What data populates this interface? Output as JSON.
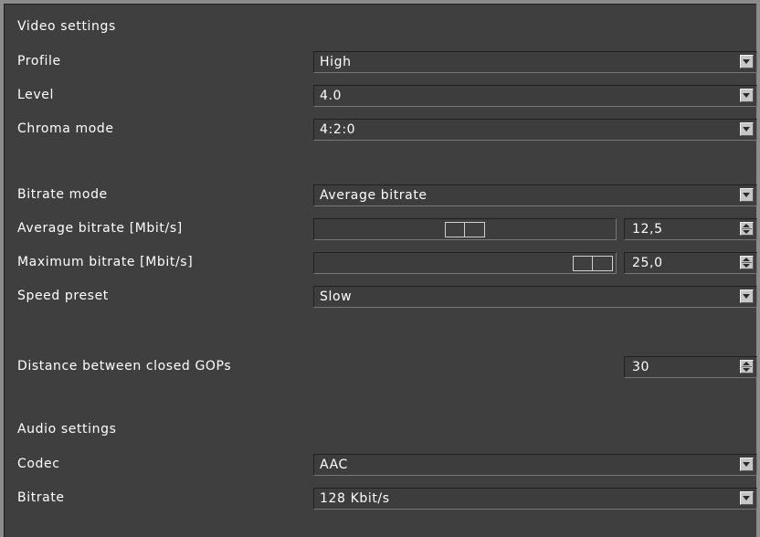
{
  "video": {
    "title": "Video settings",
    "profile": {
      "label": "Profile",
      "value": "High"
    },
    "level": {
      "label": "Level",
      "value": "4.0"
    },
    "chroma": {
      "label": "Chroma mode",
      "value": "4:2:0"
    },
    "bitrate_mode": {
      "label": "Bitrate mode",
      "value": "Average bitrate"
    },
    "avg_bitrate": {
      "label": "Average bitrate [Mbit/s]",
      "value": "12,5",
      "slider_fraction": 0.5
    },
    "max_bitrate": {
      "label": "Maximum bitrate [Mbit/s]",
      "value": "25,0",
      "slider_fraction": 1.0
    },
    "speed_preset": {
      "label": "Speed preset",
      "value": "Slow"
    },
    "gop_distance": {
      "label": "Distance between closed GOPs",
      "value": "30"
    }
  },
  "audio": {
    "title": "Audio settings",
    "codec": {
      "label": "Codec",
      "value": "AAC"
    },
    "bitrate": {
      "label": "Bitrate",
      "value": "128 Kbit/s"
    }
  },
  "icons": {
    "dropdown": "chevron-down-icon",
    "spinner": "spin-up-down-icon"
  },
  "colors": {
    "background": "#3f3f3f",
    "text": "#ffffff",
    "button": "#c6c6c6"
  }
}
